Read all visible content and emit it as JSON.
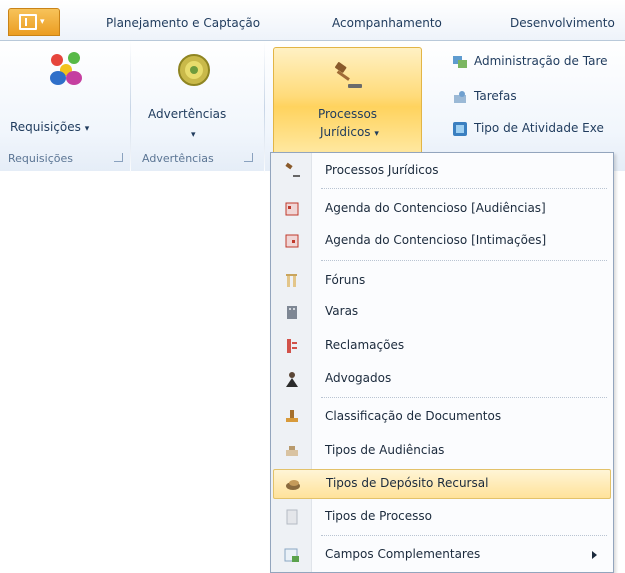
{
  "tabs": {
    "app_button_icon": "office-menu-icon",
    "items": [
      "Planejamento e Captação",
      "Acompanhamento",
      "Desenvolvimento"
    ]
  },
  "ribbon": {
    "requisicoes": {
      "label": "Requisições",
      "group": "Requisições",
      "icon": "people-icon"
    },
    "advertencias": {
      "label": "Advertências",
      "group": "Advertências",
      "icon": "warning-badge-icon"
    },
    "processos": {
      "label_line1": "Processos",
      "label_line2": "Jurídicos",
      "icon": "gavel-icon"
    },
    "small_items": [
      {
        "label": "Administração de Tare",
        "icon": "admin-icon"
      },
      {
        "label": "Tarefas",
        "icon": "tasks-icon"
      },
      {
        "label": "Tipo de Atividade Exe",
        "icon": "activity-type-icon"
      }
    ]
  },
  "menu": {
    "items": [
      {
        "label": "Processos Jurídicos",
        "icon": "gavel-icon"
      },
      {
        "label": "Agenda do Contencioso [Audiências]",
        "icon": "calendar-icon"
      },
      {
        "label": "Agenda do Contencioso [Intimações]",
        "icon": "calendar-icon"
      },
      {
        "label": "Fóruns",
        "icon": "columns-icon"
      },
      {
        "label": "Varas",
        "icon": "building-icon"
      },
      {
        "label": "Reclamações",
        "icon": "complaint-icon"
      },
      {
        "label": "Advogados",
        "icon": "lawyer-icon"
      },
      {
        "label": "Classificação de Documentos",
        "icon": "stamp-icon"
      },
      {
        "label": "Tipos de Audiências",
        "icon": "hearing-icon"
      },
      {
        "label": "Tipos de Depósito Recursal",
        "icon": "deposit-icon"
      },
      {
        "label": "Tipos de Processo",
        "icon": "document-icon"
      },
      {
        "label": "Campos Complementares",
        "icon": "fields-icon"
      }
    ],
    "selected_index": 9
  },
  "colors": {
    "accent_orange": "#eb9d22",
    "hover_yellow": "#ffdb7a",
    "ribbon_text": "#1f3b5d"
  }
}
